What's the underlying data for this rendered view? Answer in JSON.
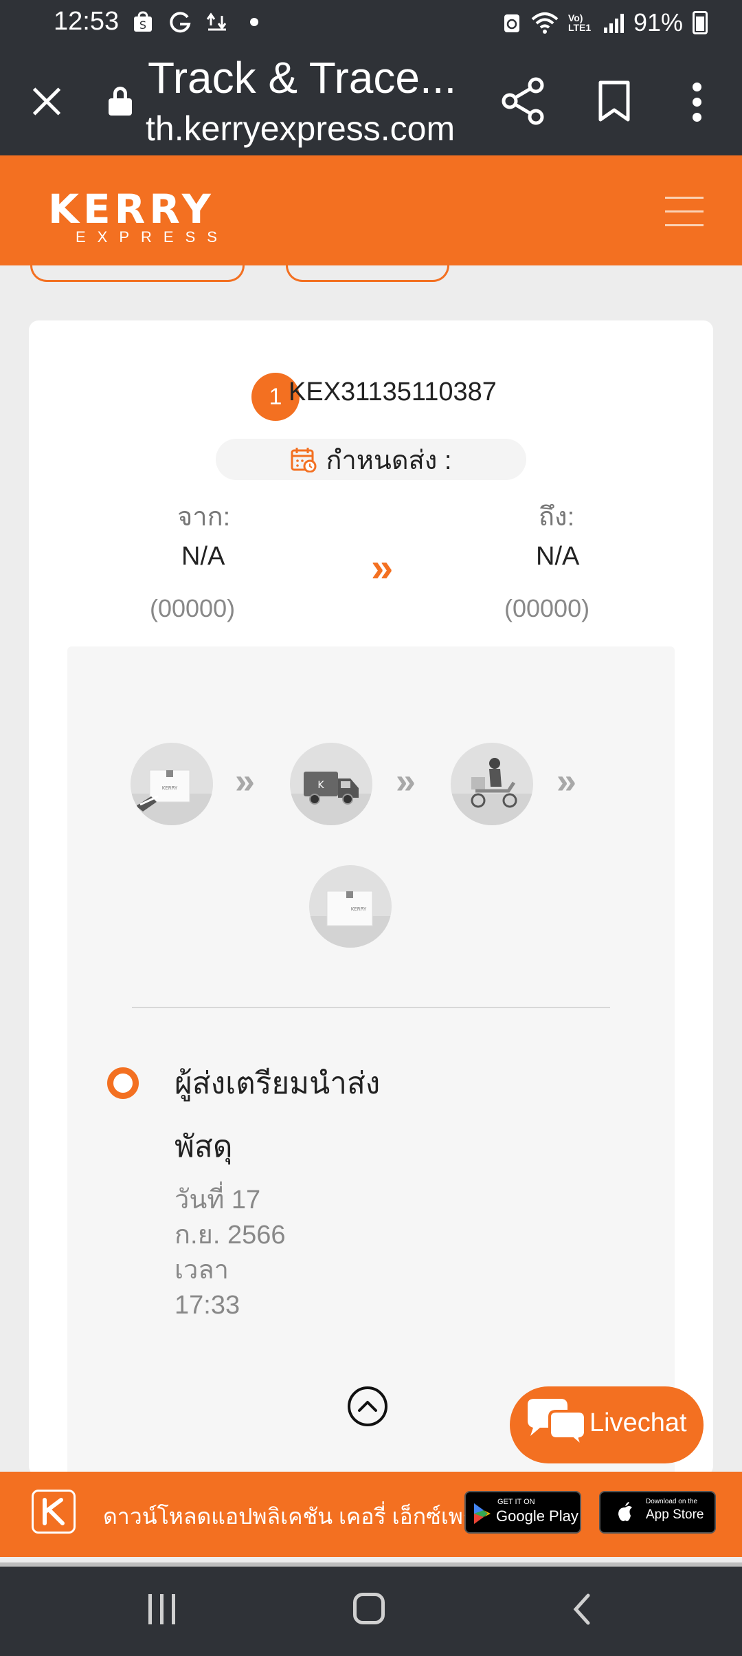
{
  "status_bar": {
    "time": "12:53",
    "battery": "91%",
    "network": "Vo) LTE1"
  },
  "browser": {
    "title": "Track & Trace...",
    "url": "th.kerryexpress.com",
    "icons": [
      "close-icon",
      "lock-icon",
      "share-icon",
      "bookmark-icon",
      "more-icon"
    ]
  },
  "header": {
    "logo_main": "KERRY",
    "logo_sub": "EXPRESS",
    "brand_color": "#f37021"
  },
  "shipment": {
    "index": "1",
    "tracking_number": "KEX31135110387",
    "due_label": "กำหนดส่ง :",
    "from_label": "จาก:",
    "from_value": "N/A",
    "from_zip": "(00000)",
    "to_label": "ถึง:",
    "to_value": "N/A",
    "to_zip": "(00000)",
    "steps": [
      "package-pickup-icon",
      "truck-icon",
      "scooter-courier-icon",
      "delivered-package-icon"
    ],
    "status_title_line1": "ผู้ส่งเตรียมนำส่ง",
    "status_title_line2": "พัสดุ",
    "status_date_line1": "วันที่ 17",
    "status_date_line2": "ก.ย. 2566",
    "status_date_line3": "เวลา",
    "status_date_line4": "17:33"
  },
  "livechat": {
    "label": "Livechat"
  },
  "download_banner": {
    "text": "ดาวน์โหลดแอปพลิเคชัน เคอรี่ เอ็กซ์เพรส",
    "google_small": "GET IT ON",
    "google_big": "Google Play",
    "apple_small": "Download on the",
    "apple_big": "App Store"
  }
}
